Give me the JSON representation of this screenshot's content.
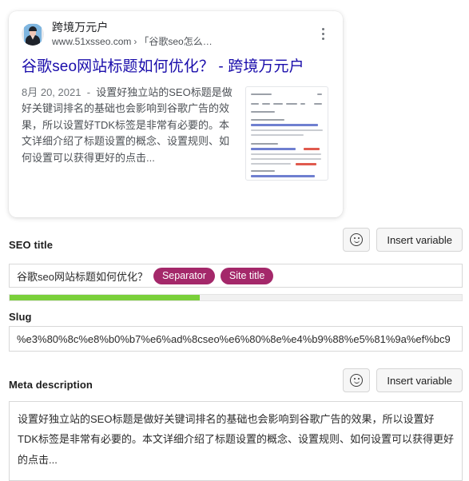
{
  "preview": {
    "site_name": "跨境万元户",
    "url_domain": "www.51xsseo.com",
    "url_separator": "›",
    "url_path": "「谷歌seo怎么…",
    "kebab_icon": "more-vert-icon",
    "avatar_icon": "avatar-photo",
    "title": "谷歌seo网站标题如何优化？ - 跨境万元户",
    "snippet_date": "8月 20, 2021",
    "snippet_dash": "-",
    "snippet_text": "设置好独立站的SEO标题是做好关键词排名的基础也会影响到谷歌广告的效果，所以设置好TDK标签是非常有必要的。本文详细介绍了标题设置的概念、设置规则、如何设置可以获得更好的点击...",
    "thumbnail_alt": "search-results-thumbnail",
    "link_color": "#1a0dab"
  },
  "seo_title": {
    "label": "SEO title",
    "emoji_button_icon": "smiley-icon",
    "insert_variable_label": "Insert variable",
    "value_text": "谷歌seo网站标题如何优化？",
    "pills": [
      "Separator",
      "Site title"
    ],
    "pill_color": "#a4286a",
    "progress_percent": 42,
    "progress_color": "#7ad03a"
  },
  "slug": {
    "label": "Slug",
    "value": "%e3%80%8c%e8%b0%b7%e6%ad%8cseo%e6%80%8e%e4%b9%88%e5%81%9a%ef%bc9"
  },
  "meta_description": {
    "label": "Meta description",
    "emoji_button_icon": "smiley-icon",
    "insert_variable_label": "Insert variable",
    "value": "设置好独立站的SEO标题是做好关键词排名的基础也会影响到谷歌广告的效果，所以设置好TDK标签是非常有必要的。本文详细介绍了标题设置的概念、设置规则、如何设置可以获得更好的点击..."
  }
}
